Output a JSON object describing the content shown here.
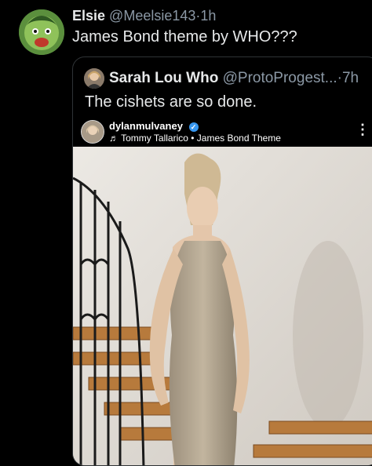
{
  "tweet": {
    "author_name": "Elsie",
    "author_handle": "@Meelsie143",
    "separator": "·",
    "time": "1h",
    "text": "James Bond theme by WHO???"
  },
  "quoted": {
    "author_name": "Sarah Lou Who",
    "author_handle": "@ProtoProgest...",
    "separator": "·",
    "time": "7h",
    "text": "The cishets are so done."
  },
  "embedded_post": {
    "username": "dylanmulvaney",
    "verified_glyph": "✓",
    "music_glyph": "♬",
    "audio": "Tommy Tallarico • James Bond Theme",
    "more_glyph": "⋮"
  },
  "icons": {
    "author_avatar": "cartoon-avatar-icon",
    "quoted_avatar": "profile-avatar-icon",
    "post_avatar": "profile-avatar-icon",
    "verified": "verified-badge-icon",
    "music": "music-note-icon",
    "more": "more-options-icon"
  },
  "colors": {
    "background": "#000000",
    "text_primary": "#e7e9ea",
    "text_secondary": "#8b98a5",
    "border": "#2f3336",
    "verified": "#3797f0"
  }
}
